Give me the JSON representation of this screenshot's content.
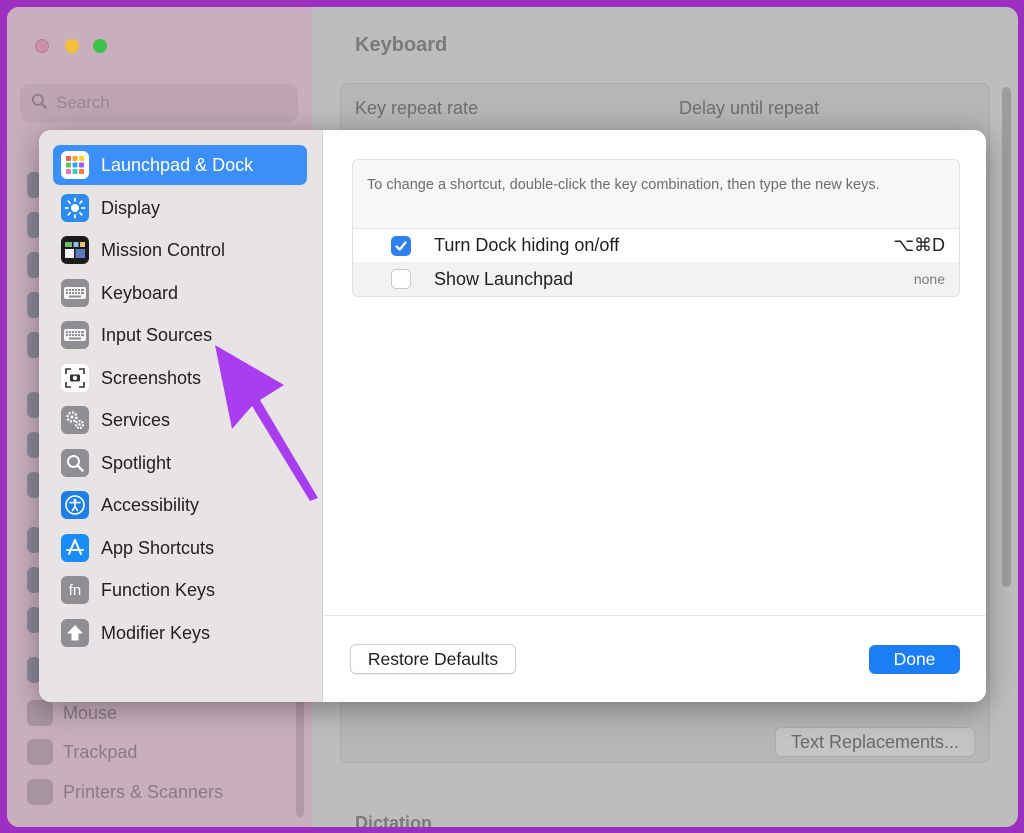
{
  "background": {
    "search_placeholder": "Search",
    "main_title": "Keyboard",
    "label_key_repeat": "Key repeat rate",
    "label_delay": "Delay until repeat",
    "text_replacements_button": "Text Replacements...",
    "dictation_heading": "Dictation",
    "sidebar_items": [
      "Mouse",
      "Trackpad",
      "Printers & Scanners"
    ]
  },
  "sheet": {
    "sidebar": {
      "items": [
        {
          "label": "Launchpad & Dock",
          "icon": "launchpad-icon",
          "selected": true
        },
        {
          "label": "Display",
          "icon": "display-icon"
        },
        {
          "label": "Mission Control",
          "icon": "mission-control-icon"
        },
        {
          "label": "Keyboard",
          "icon": "keyboard-icon"
        },
        {
          "label": "Input Sources",
          "icon": "input-sources-icon"
        },
        {
          "label": "Screenshots",
          "icon": "screenshots-icon"
        },
        {
          "label": "Services",
          "icon": "services-icon"
        },
        {
          "label": "Spotlight",
          "icon": "spotlight-icon"
        },
        {
          "label": "Accessibility",
          "icon": "accessibility-icon"
        },
        {
          "label": "App Shortcuts",
          "icon": "app-shortcuts-icon"
        },
        {
          "label": "Function Keys",
          "icon": "function-keys-icon"
        },
        {
          "label": "Modifier Keys",
          "icon": "modifier-keys-icon"
        }
      ]
    },
    "hint": "To change a shortcut, double-click the key combination, then type the new keys.",
    "shortcuts": [
      {
        "label": "Turn Dock hiding on/off",
        "keys": "⌥⌘D",
        "checked": true
      },
      {
        "label": "Show Launchpad",
        "keys": "none",
        "checked": false
      }
    ],
    "restore_defaults_label": "Restore Defaults",
    "done_label": "Done"
  },
  "colors": {
    "accent": "#3b8ff7",
    "done_button": "#1b7ef5",
    "annotation_arrow": "#a93df0",
    "page_border": "#9b2fbf"
  }
}
